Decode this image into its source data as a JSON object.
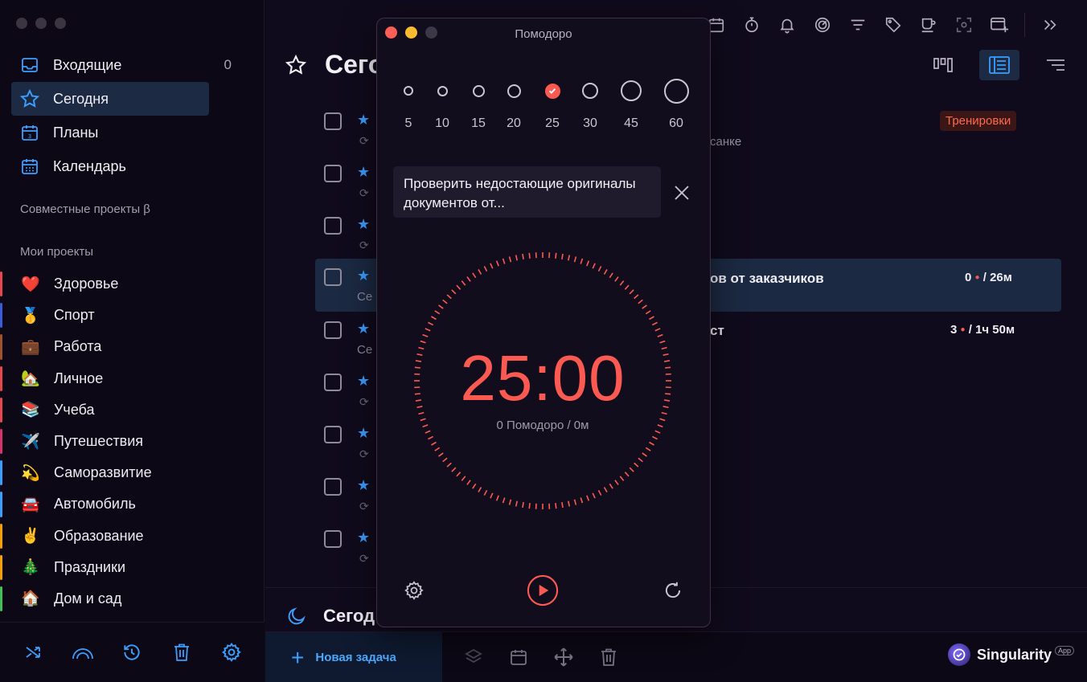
{
  "sidebar": {
    "nav": [
      {
        "label": "Входящие",
        "count": "0",
        "icon": "inbox-icon"
      },
      {
        "label": "Сегодня",
        "icon": "star-icon"
      },
      {
        "label": "Планы",
        "icon": "calendar-day-icon"
      },
      {
        "label": "Календарь",
        "icon": "calendar-grid-icon"
      }
    ],
    "shared_label": "Совместные проекты β",
    "projects_label": "Мои проекты",
    "projects": [
      {
        "label": "Здоровье",
        "emoji": "❤️",
        "color": "#e5484d"
      },
      {
        "label": "Спорт",
        "emoji": "🥇",
        "color": "#3b5bdb"
      },
      {
        "label": "Работа",
        "emoji": "💼",
        "color": "#a0522d"
      },
      {
        "label": "Личное",
        "emoji": "🏡",
        "color": "#e5484d"
      },
      {
        "label": "Учеба",
        "emoji": "📚",
        "color": "#e5484d"
      },
      {
        "label": "Путешествия",
        "emoji": "✈️",
        "color": "#d6336c"
      },
      {
        "label": "Саморазвитие",
        "emoji": "💫",
        "color": "#3b9eff"
      },
      {
        "label": "Автомобиль",
        "emoji": "🚘",
        "color": "#3b9eff"
      },
      {
        "label": "Образование",
        "emoji": "✌️",
        "color": "#f59f00"
      },
      {
        "label": "Праздники",
        "emoji": "🎄",
        "color": "#f59f00"
      },
      {
        "label": "Дом и сад",
        "emoji": "🏠",
        "color": "#40c057"
      }
    ],
    "footer_icons": [
      "shuffle-icon",
      "rainbow-icon",
      "history-icon",
      "trash-icon",
      "settings-icon"
    ]
  },
  "main": {
    "title": "Сего",
    "evening_title": "Сегод",
    "tasks": {
      "row1_sub": "санке",
      "row1_tag": "Тренировки",
      "row4_text": "ов от заказчиков",
      "row4_stat_count": "0",
      "row4_stat_time": "/ 26м",
      "row4_sub": "Се",
      "row5_text": "ст",
      "row5_stat_count": "3",
      "row5_stat_time": "/ 1ч 50м",
      "row5_sub": "Се"
    },
    "new_task_label": "Новая задача",
    "brand": "Singularity",
    "brand_badge": "App"
  },
  "pomodoro": {
    "title": "Помодоро",
    "durations": [
      "5",
      "10",
      "15",
      "20",
      "25",
      "30",
      "45",
      "60"
    ],
    "selected": "25",
    "task_text": "Проверить недостающие оригиналы документов от...",
    "timer": "25:00",
    "stats": "0 Помодоро / 0м",
    "accent": "#ff5a52"
  }
}
